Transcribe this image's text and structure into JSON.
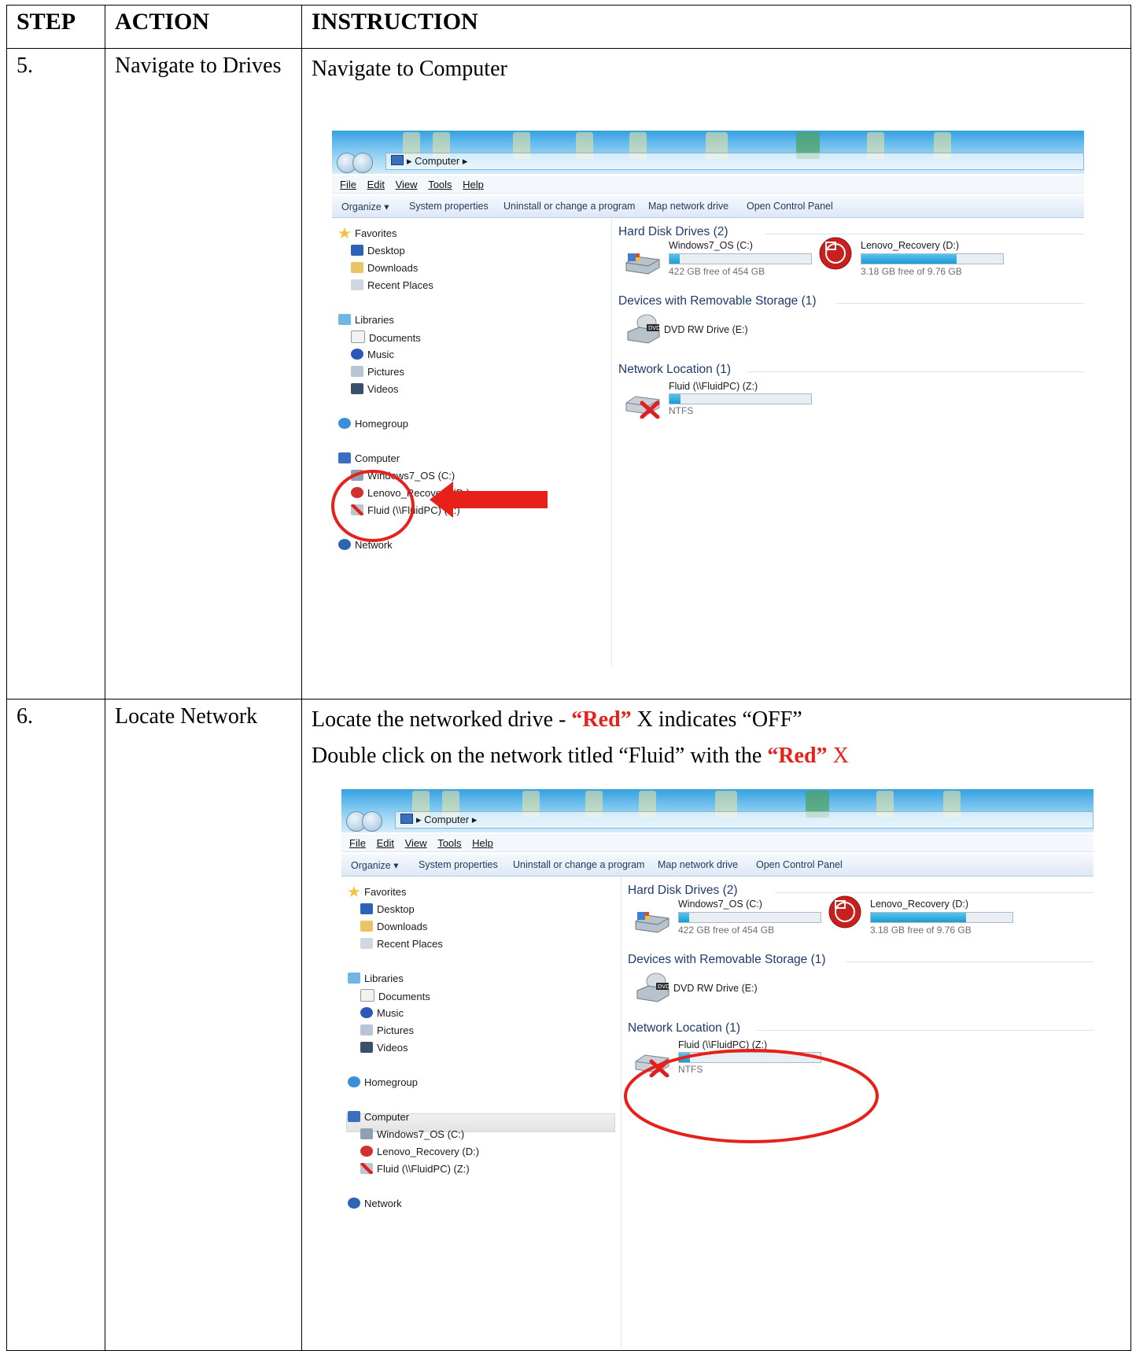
{
  "table": {
    "headers": {
      "step": "STEP",
      "action": "ACTION",
      "instruction": "INSTRUCTION"
    },
    "rows": [
      {
        "step": "5.",
        "action": "Navigate to Drives",
        "instruction_lines": [
          "Navigate to Computer"
        ]
      },
      {
        "step": "6.",
        "action": "Locate Network",
        "line1_pre": "Locate the networked drive  - ",
        "line1_red": "“Red”",
        "line1_post": " X indicates “OFF”",
        "line2_pre": "Double click on the network titled “Fluid” with the ",
        "line2_red": "“Red”",
        "line2_post": " X"
      }
    ]
  },
  "explorer": {
    "address": "Computer",
    "menu": [
      "File",
      "Edit",
      "View",
      "Tools",
      "Help"
    ],
    "commands": [
      "Organize ▾",
      "System properties",
      "Uninstall or change a program",
      "Map network drive",
      "Open Control Panel"
    ],
    "nav": {
      "favorites": "Favorites",
      "desktop": "Desktop",
      "downloads": "Downloads",
      "recent": "Recent Places",
      "libraries": "Libraries",
      "documents": "Documents",
      "music": "Music",
      "pictures": "Pictures",
      "videos": "Videos",
      "homegroup": "Homegroup",
      "computer": "Computer",
      "drive_c": "Windows7_OS (C:)",
      "drive_d": "Lenovo_Recovery (D:)",
      "drive_z": "Fluid (\\\\FluidPC) (Z:)",
      "network": "Network"
    },
    "groups": {
      "hdd": "Hard Disk Drives (2)",
      "removable": "Devices with Removable Storage (1)",
      "network": "Network Location (1)"
    },
    "drives": {
      "c_name": "Windows7_OS (C:)",
      "c_free": "422 GB free of 454 GB",
      "c_used_fraction": 0.07,
      "d_name": "Lenovo_Recovery (D:)",
      "d_free": "3.18 GB free of 9.76 GB",
      "d_used_fraction": 0.67,
      "e_name": "DVD RW Drive (E:)",
      "z_name": "Fluid (\\\\FluidPC) (Z:)",
      "z_fs": "NTFS",
      "z_used_fraction": 0.08
    },
    "colors": {
      "annotation_red": "#e8201a",
      "bar_fill": "#1a9bd4"
    }
  }
}
